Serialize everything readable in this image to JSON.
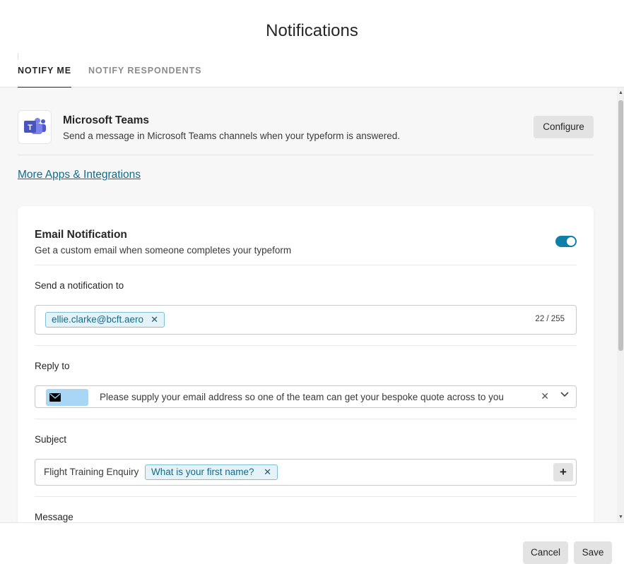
{
  "dialog": {
    "title": "Notifications"
  },
  "tabs": [
    {
      "label": "NOTIFY ME",
      "active": true
    },
    {
      "label": "NOTIFY RESPONDENTS",
      "active": false
    }
  ],
  "integration": {
    "icon": "microsoft-teams-icon",
    "name": "Microsoft Teams",
    "description": "Send a message in Microsoft Teams channels when your typeform is answered.",
    "configure_label": "Configure"
  },
  "more_apps_link": "More Apps & Integrations",
  "email_notification": {
    "title": "Email Notification",
    "description": "Get a custom email when someone completes your typeform",
    "enabled": true,
    "send_to": {
      "label": "Send a notification to",
      "recipients": [
        "ellie.clarke@bcft.aero"
      ],
      "counter": "22 / 255"
    },
    "reply_to": {
      "label": "Reply to",
      "tag_icon": "envelope-icon",
      "value": "Please supply your email address so one of the team can get your bespoke quote across to you"
    },
    "subject": {
      "label": "Subject",
      "prefix": "Flight Training Enquiry",
      "variable": "What is your first name?",
      "add_label": "+"
    },
    "message": {
      "label": "Message"
    }
  },
  "footer": {
    "cancel_label": "Cancel",
    "save_label": "Save"
  },
  "colors": {
    "accent": "#0d7fa8",
    "link": "#136a8a",
    "chip_bg": "#e5f3f8",
    "reply_tag": "#a9d6f4",
    "button_bg": "#e3e3e3"
  }
}
